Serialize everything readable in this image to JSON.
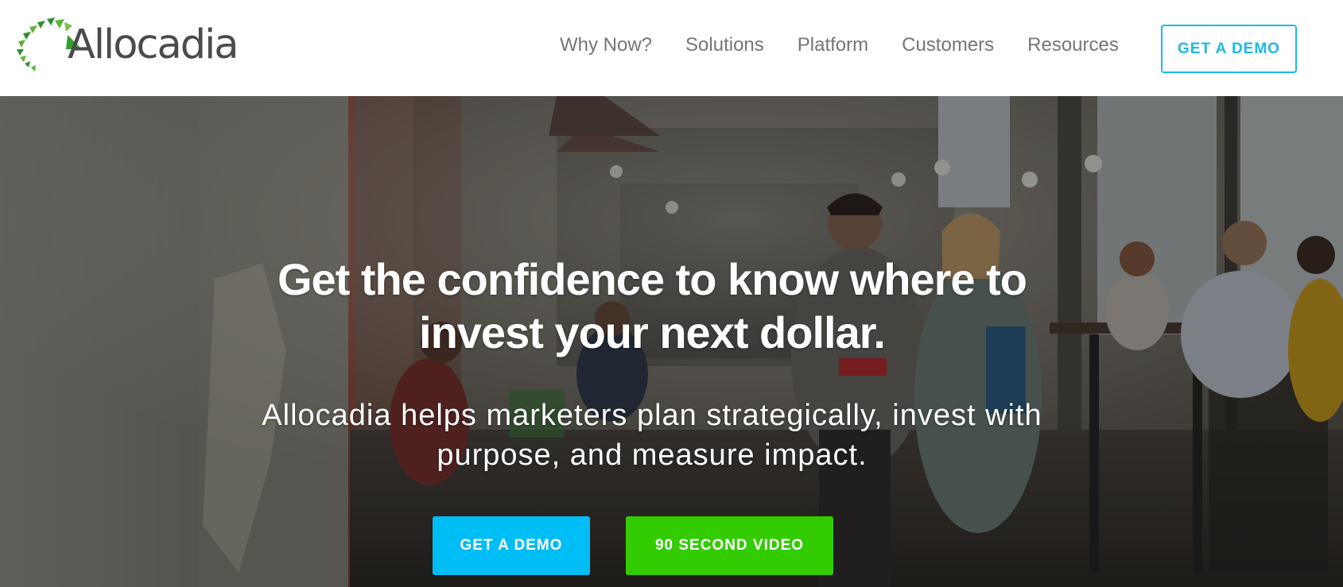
{
  "header": {
    "logo_text": "Allocadia",
    "nav": [
      {
        "label": "Why Now?"
      },
      {
        "label": "Solutions"
      },
      {
        "label": "Platform"
      },
      {
        "label": "Customers"
      },
      {
        "label": "Resources"
      }
    ],
    "cta_label": "GET A DEMO"
  },
  "hero": {
    "headline_line1": "Get the confidence to know where to",
    "headline_line2": "invest your next dollar.",
    "subline_line1": "Allocadia helps marketers plan strategically, invest with",
    "subline_line2": "purpose, and measure impact.",
    "demo_button": "GET A DEMO",
    "video_button": "90 SECOND VIDEO"
  },
  "colors": {
    "brand_green": "#5fb23a",
    "accent_cyan": "#00bdf6",
    "cta_green": "#33cc00",
    "nav_text": "#75757a"
  },
  "icons": [
    "allocadia-logo-mark"
  ]
}
